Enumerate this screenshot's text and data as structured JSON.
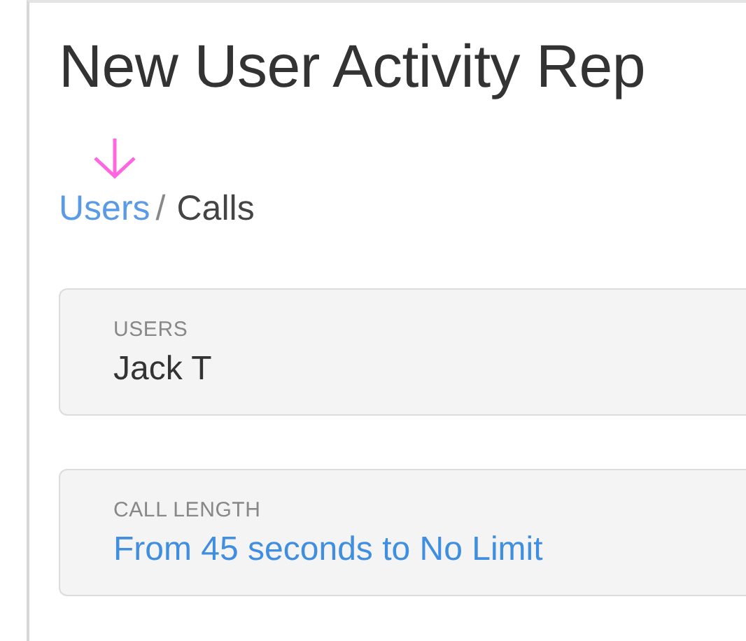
{
  "title": "New User Activity Rep",
  "breadcrumb": [
    {
      "label": "Users",
      "link": true
    },
    {
      "label": "Calls",
      "link": false
    }
  ],
  "breadcrumb_separator": "/",
  "filters": [
    {
      "label": "USERS",
      "value": "Jack T",
      "link": false
    },
    {
      "label": "CALL LENGTH",
      "value": "From 45 seconds to No Limit",
      "link": true
    }
  ]
}
